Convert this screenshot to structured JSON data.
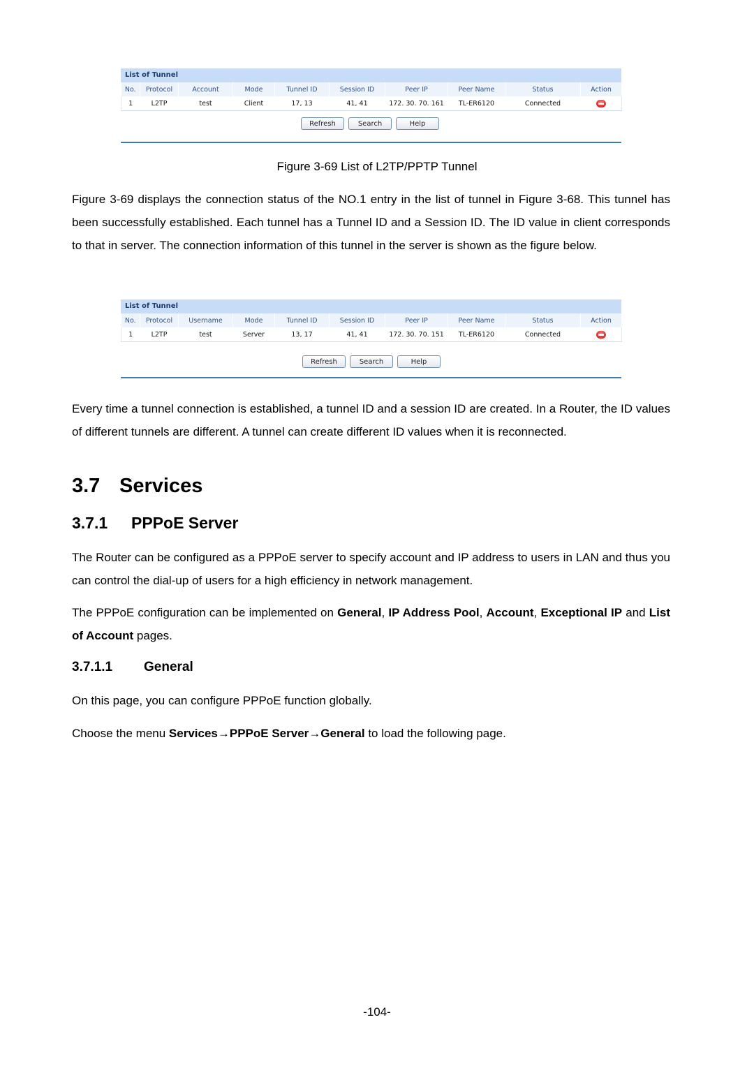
{
  "figure1": {
    "panel_title": "List of Tunnel",
    "columns": [
      "No.",
      "Protocol",
      "Account",
      "Mode",
      "Tunnel ID",
      "Session ID",
      "Peer IP",
      "Peer Name",
      "Status",
      "Action"
    ],
    "rows": [
      {
        "no": "1",
        "protocol": "L2TP",
        "account": "test",
        "mode": "Client",
        "tunnel_id": "17, 13",
        "session_id": "41, 41",
        "peer_ip": "172. 30. 70. 161",
        "peer_name": "TL-ER6120",
        "status": "Connected",
        "action_icon": "delete-icon"
      }
    ],
    "buttons": {
      "refresh": "Refresh",
      "search": "Search",
      "help": "Help"
    },
    "caption": "Figure 3-69 List of L2TP/PPTP Tunnel"
  },
  "para1": "Figure 3-69 displays the connection status of the NO.1 entry in the list of tunnel in Figure 3-68. This tunnel has been successfully established. Each tunnel has a Tunnel ID and a Session ID. The ID value in client corresponds to that in server. The connection information of this tunnel in the server is shown as the figure below.",
  "figure2": {
    "panel_title": "List of Tunnel",
    "columns": [
      "No.",
      "Protocol",
      "Username",
      "Mode",
      "Tunnel ID",
      "Session ID",
      "Peer IP",
      "Peer Name",
      "Status",
      "Action"
    ],
    "rows": [
      {
        "no": "1",
        "protocol": "L2TP",
        "account": "test",
        "mode": "Server",
        "tunnel_id": "13, 17",
        "session_id": "41, 41",
        "peer_ip": "172. 30. 70. 151",
        "peer_name": "TL-ER6120",
        "status": "Connected",
        "action_icon": "delete-icon"
      }
    ],
    "buttons": {
      "refresh": "Refresh",
      "search": "Search",
      "help": "Help"
    }
  },
  "para2": "Every time a tunnel connection is established, a tunnel ID and a session ID are created. In a Router, the ID values of different tunnels are different. A tunnel can create different ID values when it is reconnected.",
  "section": {
    "number": "3.7",
    "title": "Services"
  },
  "subsection": {
    "number": "3.7.1",
    "title": "PPPoE Server"
  },
  "para3": "The Router can be configured as a PPPoE server to specify account and IP address to users in LAN and thus you can control the dial-up of users for a high efficiency in network management.",
  "para4": {
    "prefix": "The PPPoE configuration can be implemented on ",
    "b1": "General",
    "s1": ", ",
    "b2": "IP Address Pool",
    "s2": ", ",
    "b3": "Account",
    "s3": ", ",
    "b4": "Exceptional IP",
    "s4": " and ",
    "b5": "List of Account",
    "suffix": " pages."
  },
  "subsubsection": {
    "number": "3.7.1.1",
    "title": "General"
  },
  "para5": "On this page, you can configure PPPoE function globally.",
  "para6": {
    "prefix": "Choose the menu ",
    "b1": "Services",
    "arrow1": "→",
    "b2": "PPPoE Server",
    "arrow2": "→",
    "b3": "General",
    "suffix": " to load the following page."
  },
  "page_number": "-104-"
}
